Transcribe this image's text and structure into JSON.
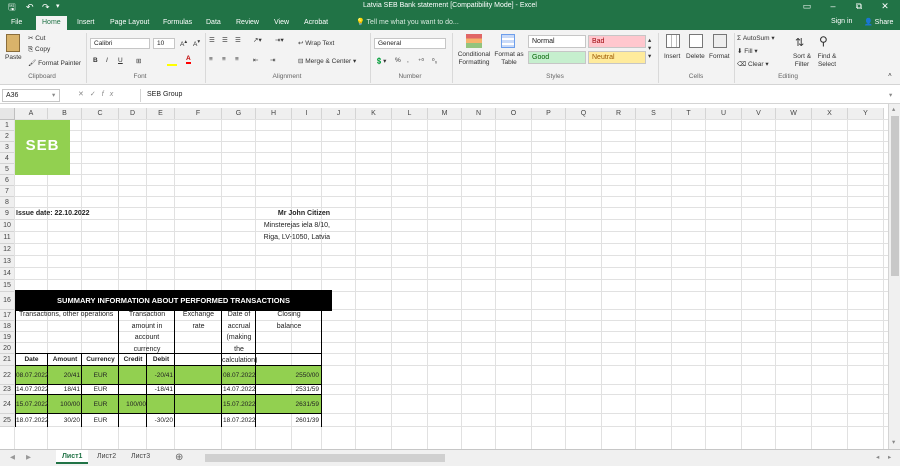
{
  "window": {
    "title": "Latvia SEB Bank statement  [Compatibility Mode] - Excel",
    "controls": [
      "–",
      "⧉",
      "✕"
    ]
  },
  "tabs": [
    "File",
    "Home",
    "Insert",
    "Page Layout",
    "Formulas",
    "Data",
    "Review",
    "View",
    "Acrobat"
  ],
  "tell_me": "Tell me what you want to do...",
  "sign_in": "Sign in",
  "share": "Share",
  "ribbon": {
    "paste": "Paste",
    "cut": "Cut",
    "copy": "Copy",
    "format_painter": "Format Painter",
    "font_name": "Calibri",
    "font_size": "10",
    "wrap_text": "Wrap Text",
    "merge_center": "Merge & Center",
    "number_format": "General",
    "conditional_formatting": "Conditional Formatting",
    "format_as_table": "Format as Table",
    "style_normal": "Normal",
    "style_bad": "Bad",
    "style_good": "Good",
    "style_neutral": "Neutral",
    "insert": "Insert",
    "delete": "Delete",
    "format": "Format",
    "autosum": "AutoSum",
    "fill": "Fill",
    "clear": "Clear",
    "sort_filter": "Sort & Filter",
    "find_select": "Find & Select",
    "groups": {
      "clipboard": "Clipboard",
      "font": "Font",
      "alignment": "Alignment",
      "number": "Number",
      "styles": "Styles",
      "cells": "Cells",
      "editing": "Editing"
    }
  },
  "formula_bar": {
    "name_box": "A36",
    "formula": "SEB Group"
  },
  "columns": [
    "A",
    "B",
    "C",
    "D",
    "E",
    "F",
    "G",
    "H",
    "I",
    "J",
    "K",
    "L",
    "M",
    "N",
    "O",
    "P",
    "Q",
    "R",
    "S",
    "T",
    "U",
    "V",
    "W",
    "X",
    "Y"
  ],
  "rows": [
    "1",
    "2",
    "3",
    "4",
    "5",
    "6",
    "7",
    "8",
    "9",
    "10",
    "11",
    "12",
    "13",
    "14",
    "15",
    "16",
    "17",
    "18",
    "19",
    "20",
    "21",
    "22",
    "23",
    "24",
    "25"
  ],
  "sheet": {
    "logo": "SEB",
    "issue_date": "Issue date: 22.10.2022",
    "recipient_name": "Mr John Citizen",
    "address1": "Minsterejas iela 8/10,",
    "address2": "Riga, LV-1050, Latvia",
    "summary_title": "SUMMARY INFORMATION ABOUT PERFORMED TRANSACTIONS",
    "hdr_transactions": "Transactions, other operations",
    "hdr_tx_amount": [
      "Transaction",
      "amount in",
      "account",
      "currency"
    ],
    "hdr_exchange": [
      "Exchange",
      "rate"
    ],
    "hdr_date_accrual": [
      "Date of",
      "accrual",
      "(making",
      "the",
      "calculation)"
    ],
    "hdr_closing": [
      "Closing",
      "balance"
    ],
    "sub_headers": [
      "Date",
      "Amount",
      "Currency",
      "Credit",
      "Debit"
    ],
    "transactions": [
      {
        "date": "08.07.2022",
        "amount": "20/41",
        "currency": "EUR",
        "credit": "",
        "debit": "-20/41",
        "accrual": "08.07.2022",
        "balance": "2550/00",
        "green": true
      },
      {
        "date": "14.07.2022",
        "amount": "18/41",
        "currency": "EUR",
        "credit": "",
        "debit": "-18/41",
        "accrual": "14.07.2022",
        "balance": "2531/59",
        "green": false
      },
      {
        "date": "15.07.2022",
        "amount": "100/00",
        "currency": "EUR",
        "credit": "100/00",
        "debit": "",
        "accrual": "15.07.2022",
        "balance": "2631/59",
        "green": true
      },
      {
        "date": "18.07.2022",
        "amount": "30/20",
        "currency": "EUR",
        "credit": "",
        "debit": "-30/20",
        "accrual": "18.07.2022",
        "balance": "2601/39",
        "green": false
      }
    ]
  },
  "sheet_tabs": [
    "Лист1",
    "Лист2",
    "Лист3"
  ]
}
